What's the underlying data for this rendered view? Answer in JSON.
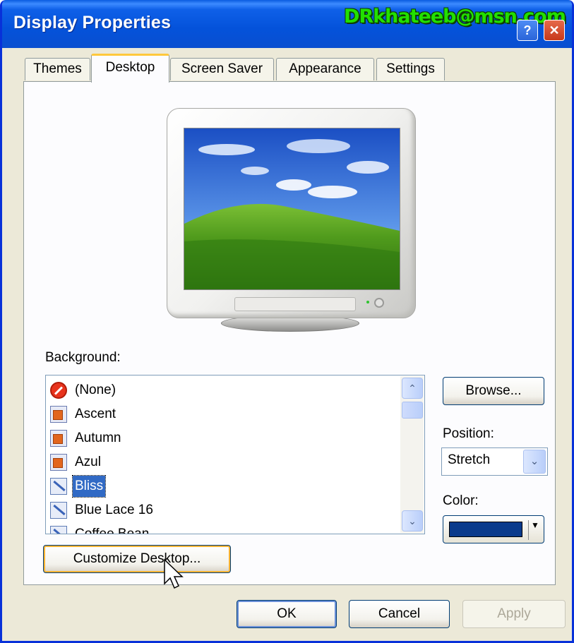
{
  "window": {
    "title": "Display Properties",
    "watermark": "DRkhateeb@msn.com",
    "help_glyph": "?",
    "close_glyph": "✕"
  },
  "tabs": [
    {
      "label": "Themes",
      "active": false
    },
    {
      "label": "Desktop",
      "active": true
    },
    {
      "label": "Screen Saver",
      "active": false
    },
    {
      "label": "Appearance",
      "active": false
    },
    {
      "label": "Settings",
      "active": false
    }
  ],
  "background": {
    "label": "Background:",
    "items": [
      {
        "label": "(None)",
        "icon": "no-entry-icon",
        "selected": false
      },
      {
        "label": "Ascent",
        "icon": "image-file-icon",
        "selected": false
      },
      {
        "label": "Autumn",
        "icon": "image-file-icon",
        "selected": false
      },
      {
        "label": "Azul",
        "icon": "image-file-icon",
        "selected": false
      },
      {
        "label": "Bliss",
        "icon": "bitmap-file-icon",
        "selected": true
      },
      {
        "label": "Blue Lace 16",
        "icon": "bitmap-file-icon",
        "selected": false
      },
      {
        "label": "Coffee Bean",
        "icon": "bitmap-file-icon",
        "selected": false
      }
    ]
  },
  "buttons": {
    "browse": "Browse...",
    "customize": "Customize Desktop...",
    "ok": "OK",
    "cancel": "Cancel",
    "apply": "Apply"
  },
  "position": {
    "label": "Position:",
    "value": "Stretch"
  },
  "color": {
    "label": "Color:",
    "value": "#0a3a8c"
  },
  "scrollbar": {
    "up_glyph": "⌃",
    "down_glyph": "⌄"
  },
  "dropdown_glyph": "⌄",
  "color_dropdown_glyph": "▼"
}
